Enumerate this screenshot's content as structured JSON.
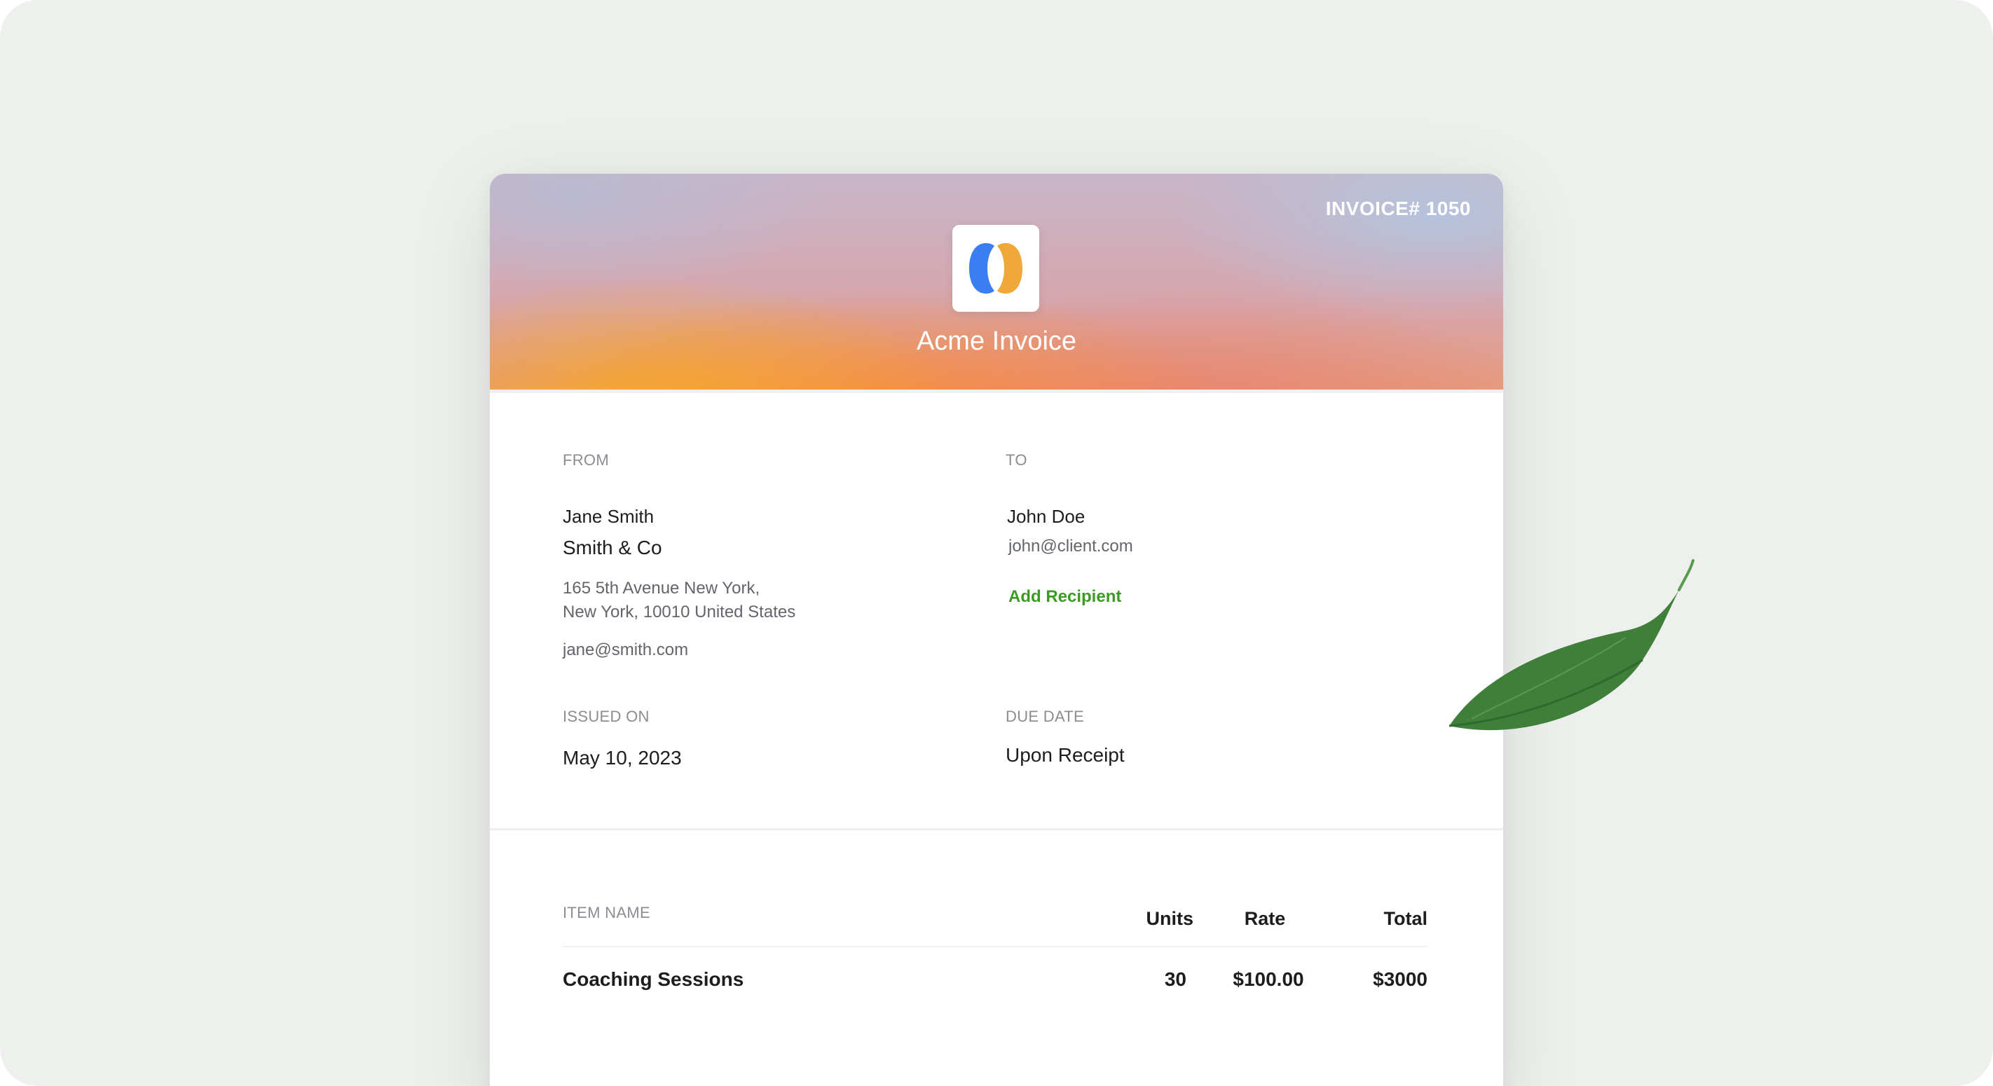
{
  "invoice": {
    "number_label": "INVOICE# 1050",
    "brand_title": "Acme Invoice",
    "logo_icon": "acme-logo-icon",
    "colors": {
      "logo_blue": "#3b7df2",
      "logo_orange": "#f0a83a",
      "link_green": "#3c9b23"
    }
  },
  "from": {
    "label": "FROM",
    "name": "Jane Smith",
    "company": "Smith & Co",
    "address_line1": "165 5th Avenue New York,",
    "address_line2": "New York, 10010 United States",
    "email": "jane@smith.com"
  },
  "to": {
    "label": "TO",
    "name": "John Doe",
    "email": "john@client.com",
    "add_recipient": "Add Recipient"
  },
  "dates": {
    "issued_label": "ISSUED ON",
    "issued_value": "May 10, 2023",
    "due_label": "DUE DATE",
    "due_value": "Upon Receipt"
  },
  "items": {
    "headers": {
      "name": "ITEM NAME",
      "units": "Units",
      "rate": "Rate",
      "total": "Total"
    },
    "rows": [
      {
        "name": "Coaching Sessions",
        "units": "30",
        "rate": "$100.00",
        "total": "$3000"
      }
    ]
  },
  "decor": {
    "leaf_icon": "leaf-icon"
  }
}
